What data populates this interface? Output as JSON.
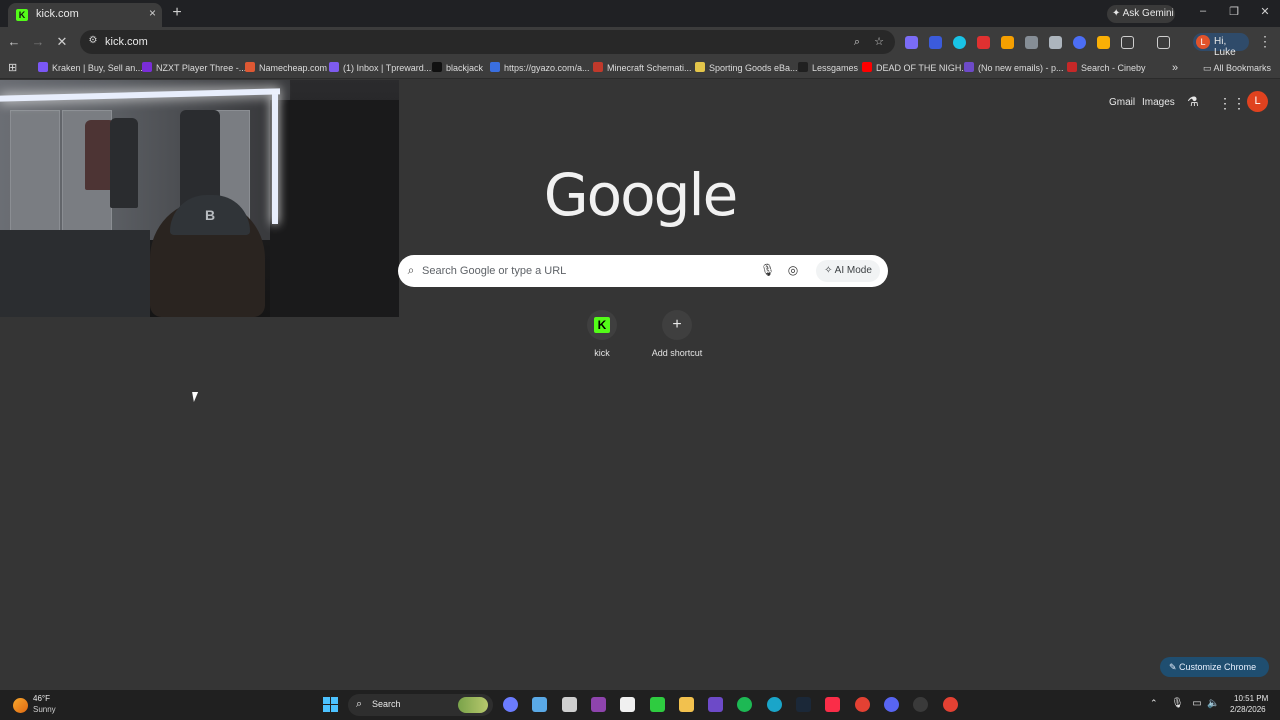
{
  "tab": {
    "title": "kick.com",
    "favicon_letter": "K",
    "close": "×"
  },
  "new_tab": "+",
  "ask_gemini": "Ask Gemini",
  "window_controls": {
    "minimize": "–",
    "restore": "❐",
    "close": "✕"
  },
  "toolbar": {
    "back": "←",
    "forward": "→",
    "reload": "✕",
    "url": "kick.com",
    "profile_initial": "L",
    "profile_name": "Hi, Luke",
    "menu": "⋮"
  },
  "bookmarks": {
    "apps_icon": "apps-grid-icon",
    "items": [
      {
        "label": "Kraken | Buy, Sell an...",
        "color": "#7b57f5"
      },
      {
        "label": "NZXT Player Three -...",
        "color": "#7a2dd8"
      },
      {
        "label": "Namecheap.com",
        "color": "#de5833"
      },
      {
        "label": "(1) Inbox | Tpreward...",
        "color": "#7e5bef"
      },
      {
        "label": "blackjack",
        "color": "#101010"
      },
      {
        "label": "https://gyazo.com/a...",
        "color": "#3a6fe0"
      },
      {
        "label": "Minecraft Schemati...",
        "color": "#c0392b"
      },
      {
        "label": "Sporting Goods eBa...",
        "color": "#e3c54a"
      },
      {
        "label": "Lessgames",
        "color": "#202020"
      },
      {
        "label": "DEAD OF THE NIGH...",
        "color": "#ff0000"
      },
      {
        "label": "(No new emails) - p...",
        "color": "#6d4ac8"
      },
      {
        "label": "Search - Cineby",
        "color": "#c62828"
      }
    ],
    "overflow": "»",
    "all_bookmarks": "All Bookmarks"
  },
  "google": {
    "gmail": "Gmail",
    "images": "Images",
    "account_initial": "L",
    "logo": "Google",
    "search_placeholder": "Search Google or type a URL",
    "ai_mode": "AI Mode",
    "shortcuts": [
      {
        "label": "kick",
        "icon": "K"
      },
      {
        "label": "Add shortcut",
        "icon": "+"
      }
    ],
    "customize": "Customize Chrome"
  },
  "taskbar": {
    "weather_temp": "46°F",
    "weather_desc": "Sunny",
    "search_label": "Search",
    "apps": [
      {
        "name": "copilot-icon",
        "color": "#6b7cff"
      },
      {
        "name": "cloud-icon",
        "color": "#5aa9e6"
      },
      {
        "name": "app-icon",
        "color": "#cfcfcf"
      },
      {
        "name": "game-icon",
        "color": "#8e44ad"
      },
      {
        "name": "document-icon",
        "color": "#f0f0f0"
      },
      {
        "name": "xbox-icon",
        "color": "#2ecc40"
      },
      {
        "name": "folder-icon",
        "color": "#f2c14e"
      },
      {
        "name": "proton-icon",
        "color": "#6d4ac8"
      },
      {
        "name": "spotify-icon",
        "color": "#1db954"
      },
      {
        "name": "edge-icon",
        "color": "#1aa5c9"
      },
      {
        "name": "steam-icon",
        "color": "#1b2838"
      },
      {
        "name": "music-icon",
        "color": "#fa2d48"
      },
      {
        "name": "chrome-icon",
        "color": "#e34133"
      },
      {
        "name": "discord-icon",
        "color": "#5865f2"
      },
      {
        "name": "obs-icon",
        "color": "#3a3a3a"
      },
      {
        "name": "chrome-profile-icon",
        "color": "#e34133"
      }
    ],
    "time": "10:51 PM",
    "date": "2/28/2026"
  }
}
